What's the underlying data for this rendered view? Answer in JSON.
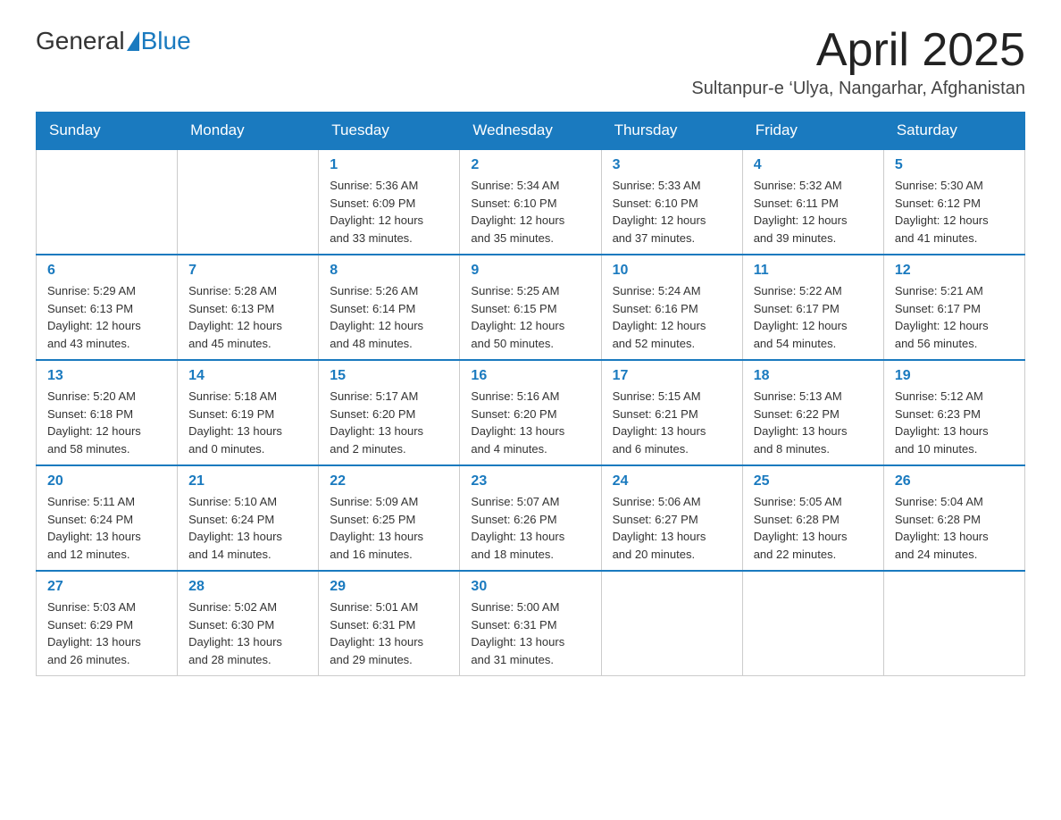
{
  "header": {
    "logo_general": "General",
    "logo_blue": "Blue",
    "month_title": "April 2025",
    "location": "Sultanpur-e ‘Ulya, Nangarhar, Afghanistan"
  },
  "weekdays": [
    "Sunday",
    "Monday",
    "Tuesday",
    "Wednesday",
    "Thursday",
    "Friday",
    "Saturday"
  ],
  "weeks": [
    [
      {
        "day": "",
        "info": ""
      },
      {
        "day": "",
        "info": ""
      },
      {
        "day": "1",
        "info": "Sunrise: 5:36 AM\nSunset: 6:09 PM\nDaylight: 12 hours\nand 33 minutes."
      },
      {
        "day": "2",
        "info": "Sunrise: 5:34 AM\nSunset: 6:10 PM\nDaylight: 12 hours\nand 35 minutes."
      },
      {
        "day": "3",
        "info": "Sunrise: 5:33 AM\nSunset: 6:10 PM\nDaylight: 12 hours\nand 37 minutes."
      },
      {
        "day": "4",
        "info": "Sunrise: 5:32 AM\nSunset: 6:11 PM\nDaylight: 12 hours\nand 39 minutes."
      },
      {
        "day": "5",
        "info": "Sunrise: 5:30 AM\nSunset: 6:12 PM\nDaylight: 12 hours\nand 41 minutes."
      }
    ],
    [
      {
        "day": "6",
        "info": "Sunrise: 5:29 AM\nSunset: 6:13 PM\nDaylight: 12 hours\nand 43 minutes."
      },
      {
        "day": "7",
        "info": "Sunrise: 5:28 AM\nSunset: 6:13 PM\nDaylight: 12 hours\nand 45 minutes."
      },
      {
        "day": "8",
        "info": "Sunrise: 5:26 AM\nSunset: 6:14 PM\nDaylight: 12 hours\nand 48 minutes."
      },
      {
        "day": "9",
        "info": "Sunrise: 5:25 AM\nSunset: 6:15 PM\nDaylight: 12 hours\nand 50 minutes."
      },
      {
        "day": "10",
        "info": "Sunrise: 5:24 AM\nSunset: 6:16 PM\nDaylight: 12 hours\nand 52 minutes."
      },
      {
        "day": "11",
        "info": "Sunrise: 5:22 AM\nSunset: 6:17 PM\nDaylight: 12 hours\nand 54 minutes."
      },
      {
        "day": "12",
        "info": "Sunrise: 5:21 AM\nSunset: 6:17 PM\nDaylight: 12 hours\nand 56 minutes."
      }
    ],
    [
      {
        "day": "13",
        "info": "Sunrise: 5:20 AM\nSunset: 6:18 PM\nDaylight: 12 hours\nand 58 minutes."
      },
      {
        "day": "14",
        "info": "Sunrise: 5:18 AM\nSunset: 6:19 PM\nDaylight: 13 hours\nand 0 minutes."
      },
      {
        "day": "15",
        "info": "Sunrise: 5:17 AM\nSunset: 6:20 PM\nDaylight: 13 hours\nand 2 minutes."
      },
      {
        "day": "16",
        "info": "Sunrise: 5:16 AM\nSunset: 6:20 PM\nDaylight: 13 hours\nand 4 minutes."
      },
      {
        "day": "17",
        "info": "Sunrise: 5:15 AM\nSunset: 6:21 PM\nDaylight: 13 hours\nand 6 minutes."
      },
      {
        "day": "18",
        "info": "Sunrise: 5:13 AM\nSunset: 6:22 PM\nDaylight: 13 hours\nand 8 minutes."
      },
      {
        "day": "19",
        "info": "Sunrise: 5:12 AM\nSunset: 6:23 PM\nDaylight: 13 hours\nand 10 minutes."
      }
    ],
    [
      {
        "day": "20",
        "info": "Sunrise: 5:11 AM\nSunset: 6:24 PM\nDaylight: 13 hours\nand 12 minutes."
      },
      {
        "day": "21",
        "info": "Sunrise: 5:10 AM\nSunset: 6:24 PM\nDaylight: 13 hours\nand 14 minutes."
      },
      {
        "day": "22",
        "info": "Sunrise: 5:09 AM\nSunset: 6:25 PM\nDaylight: 13 hours\nand 16 minutes."
      },
      {
        "day": "23",
        "info": "Sunrise: 5:07 AM\nSunset: 6:26 PM\nDaylight: 13 hours\nand 18 minutes."
      },
      {
        "day": "24",
        "info": "Sunrise: 5:06 AM\nSunset: 6:27 PM\nDaylight: 13 hours\nand 20 minutes."
      },
      {
        "day": "25",
        "info": "Sunrise: 5:05 AM\nSunset: 6:28 PM\nDaylight: 13 hours\nand 22 minutes."
      },
      {
        "day": "26",
        "info": "Sunrise: 5:04 AM\nSunset: 6:28 PM\nDaylight: 13 hours\nand 24 minutes."
      }
    ],
    [
      {
        "day": "27",
        "info": "Sunrise: 5:03 AM\nSunset: 6:29 PM\nDaylight: 13 hours\nand 26 minutes."
      },
      {
        "day": "28",
        "info": "Sunrise: 5:02 AM\nSunset: 6:30 PM\nDaylight: 13 hours\nand 28 minutes."
      },
      {
        "day": "29",
        "info": "Sunrise: 5:01 AM\nSunset: 6:31 PM\nDaylight: 13 hours\nand 29 minutes."
      },
      {
        "day": "30",
        "info": "Sunrise: 5:00 AM\nSunset: 6:31 PM\nDaylight: 13 hours\nand 31 minutes."
      },
      {
        "day": "",
        "info": ""
      },
      {
        "day": "",
        "info": ""
      },
      {
        "day": "",
        "info": ""
      }
    ]
  ]
}
